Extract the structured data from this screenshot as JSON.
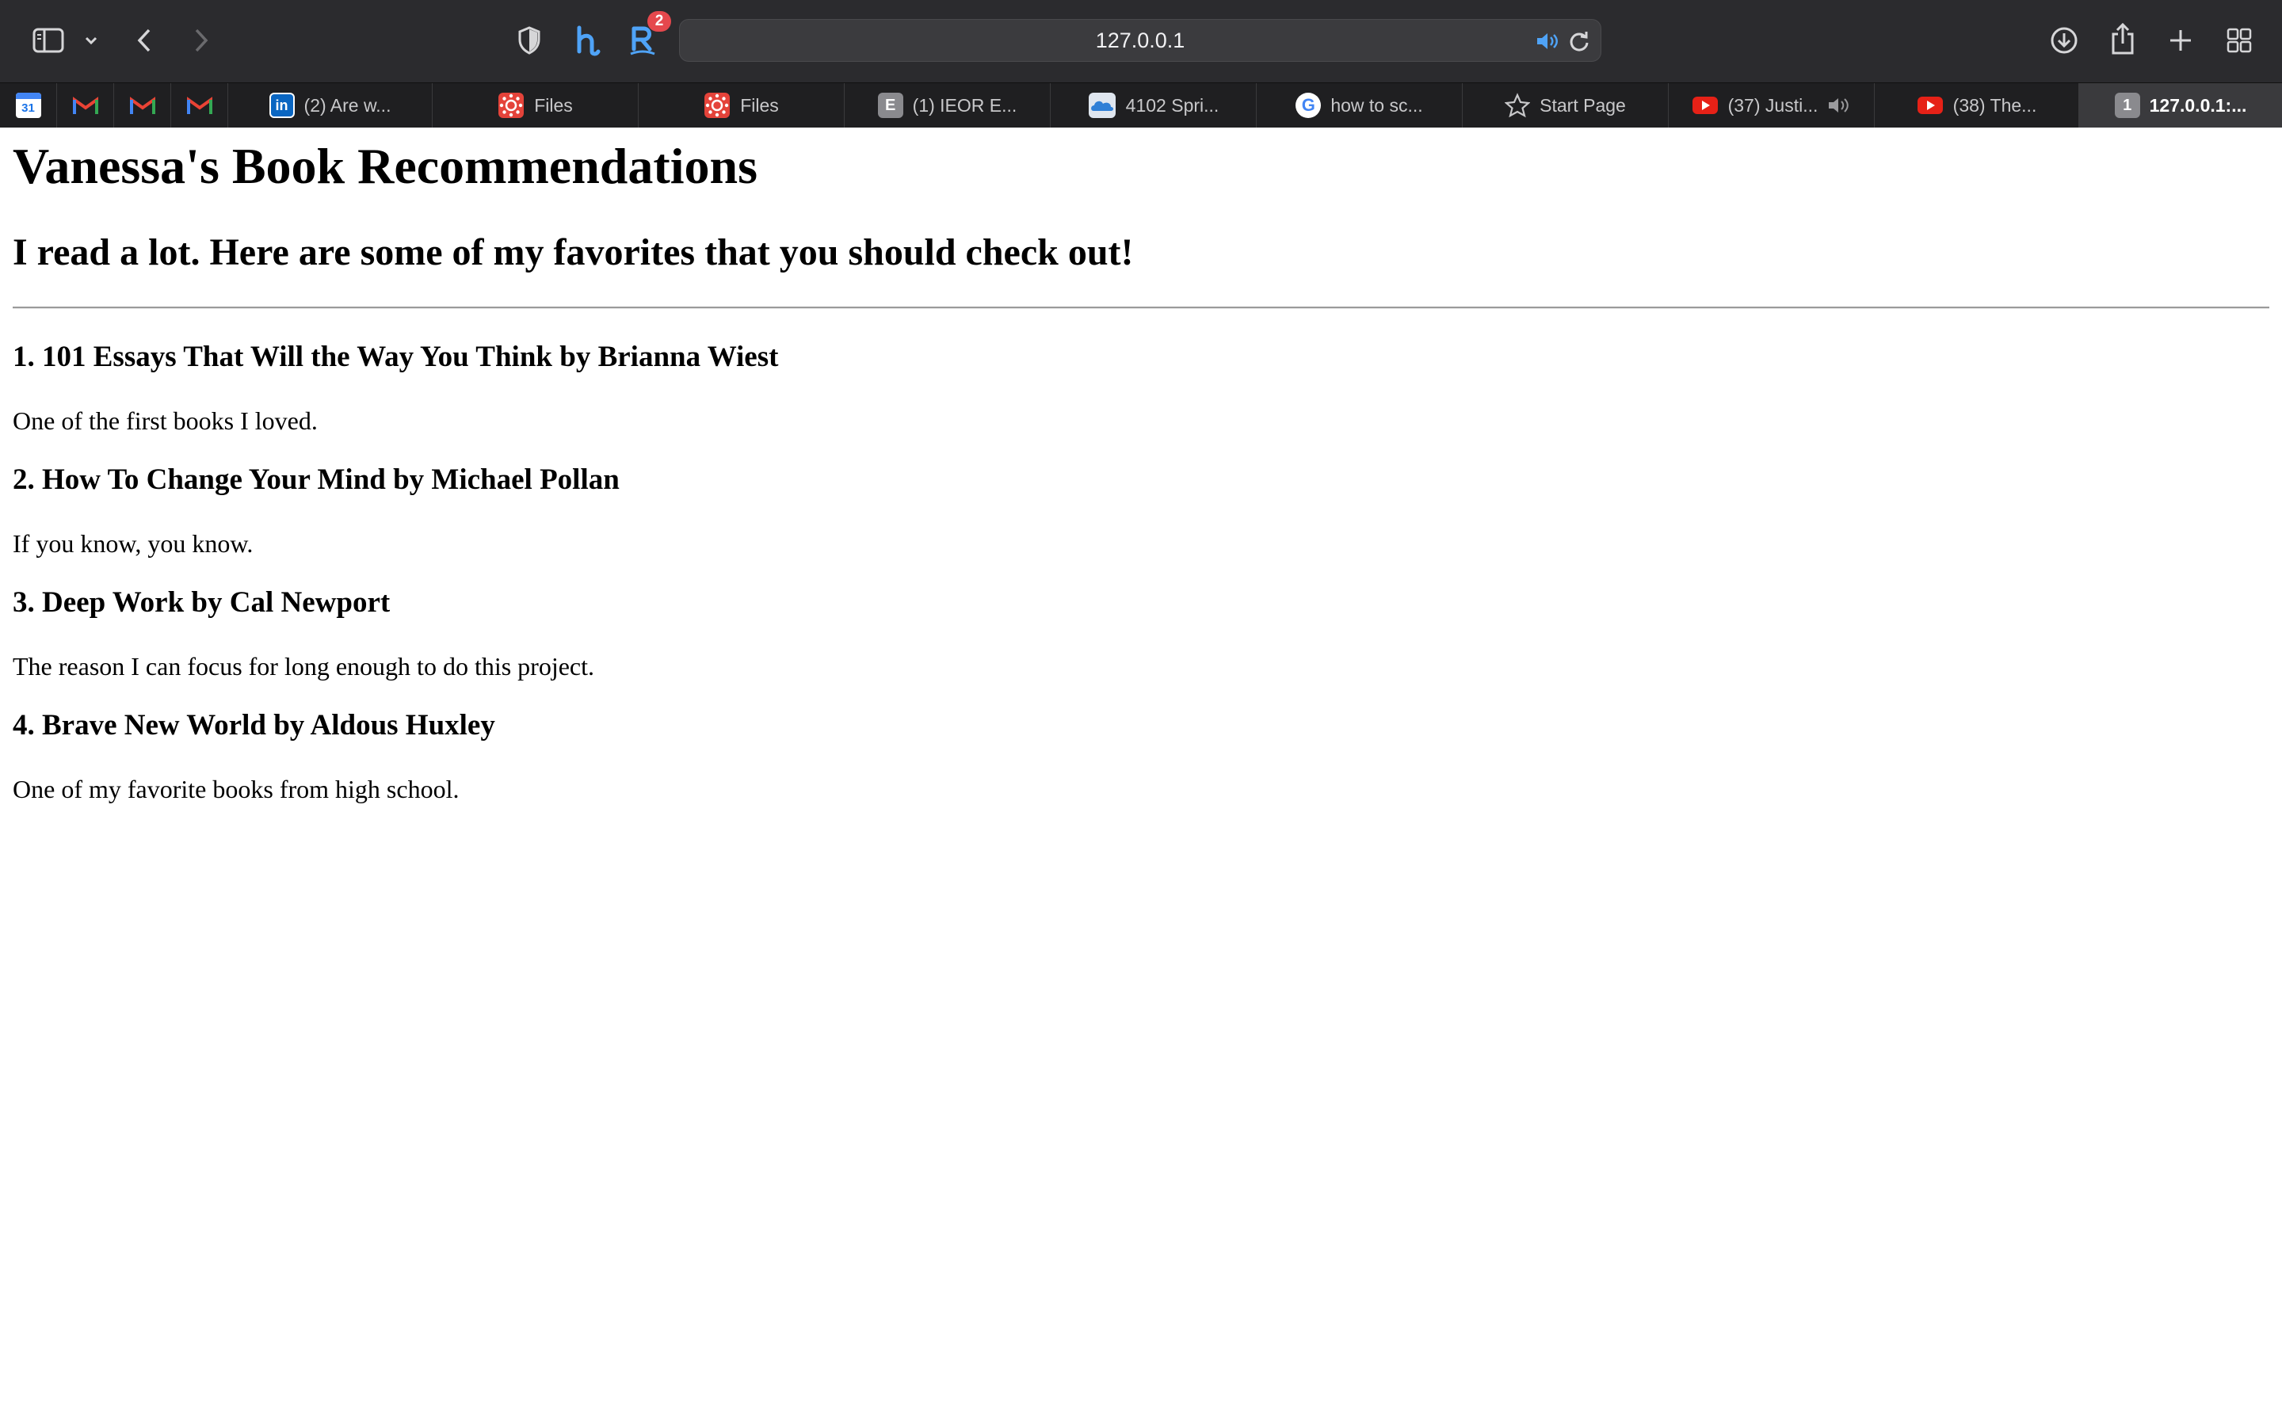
{
  "browser": {
    "address": "127.0.0.1",
    "extension_badge": "2",
    "pinned_tabs": [
      {
        "icon": "google-calendar-icon",
        "label": "31"
      },
      {
        "icon": "gmail-icon"
      },
      {
        "icon": "gmail-icon"
      },
      {
        "icon": "gmail-icon"
      }
    ],
    "tabs": [
      {
        "title": "(2) Are w...",
        "icon": "linkedin-icon",
        "icon_text": "in"
      },
      {
        "title": "Files",
        "icon": "canvas-icon"
      },
      {
        "title": "Files",
        "icon": "canvas-icon"
      },
      {
        "title": "(1) IEOR E...",
        "icon": "letter-e-icon",
        "icon_text": "E"
      },
      {
        "title": "4102 Spri...",
        "icon": "onedrive-icon"
      },
      {
        "title": "how to sc...",
        "icon": "google-icon",
        "icon_text": "G"
      },
      {
        "title": "Start Page",
        "icon": "star-icon"
      },
      {
        "title": "(37) Justi...",
        "icon": "youtube-icon"
      },
      {
        "title": "(38) The...",
        "icon": "youtube-icon"
      },
      {
        "title": "127.0.0.1:...",
        "icon": "number-icon",
        "icon_text": "1"
      }
    ]
  },
  "page": {
    "title": "Vanessa's Book Recommendations",
    "subtitle": "I read a lot. Here are some of my favorites that you should check out!",
    "books": [
      {
        "heading": "1. 101 Essays That Will the Way You Think by Brianna Wiest",
        "note": "One of the first books I loved."
      },
      {
        "heading": "2. How To Change Your Mind by Michael Pollan",
        "note": "If you know, you know."
      },
      {
        "heading": "3. Deep Work by Cal Newport",
        "note": "The reason I can focus for long enough to do this project."
      },
      {
        "heading": "4. Brave New World by Aldous Huxley",
        "note": "One of my favorite books from high school."
      }
    ]
  },
  "colors": {
    "toolbar_bg": "#2b2b2e",
    "tabbar_bg": "#1f1f21",
    "active_tab_bg": "#3a3a3d",
    "accent_blue": "#4fa3f7",
    "youtube_red": "#e62117"
  }
}
